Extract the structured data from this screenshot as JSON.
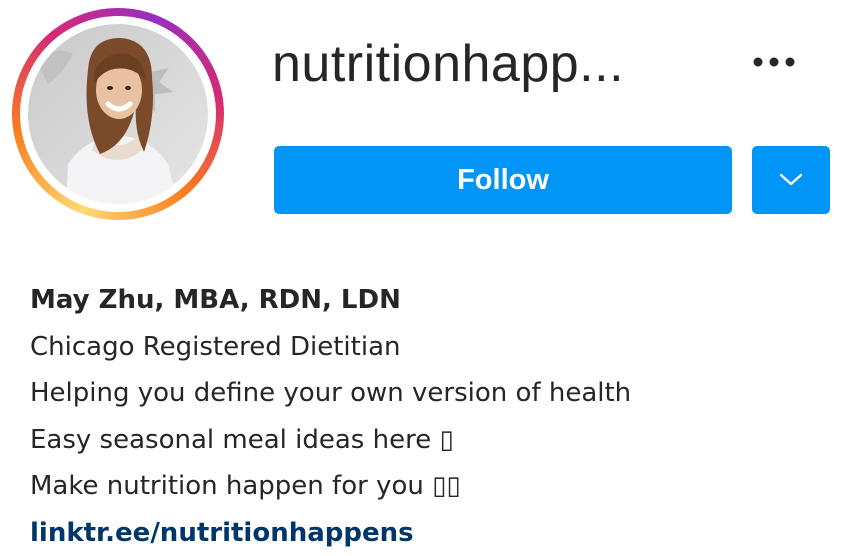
{
  "profile": {
    "username": "nutritionhapp...",
    "avatar": "profile-photo"
  },
  "actions": {
    "follow_label": "Follow",
    "more_icon": "ellipsis-icon",
    "dropdown_icon": "chevron-down-icon"
  },
  "bio": {
    "name": "May Zhu, MBA, RDN, LDN",
    "lines": [
      "Chicago Registered Dietitian",
      "Helping you define your own version of health",
      "Easy seasonal meal ideas here ▯",
      "Make nutrition happen for you ▯▯"
    ],
    "link": "linktr.ee/nutritionhappens"
  },
  "colors": {
    "primary_button": "#0095f6",
    "link": "#00376b",
    "text": "#262626"
  }
}
